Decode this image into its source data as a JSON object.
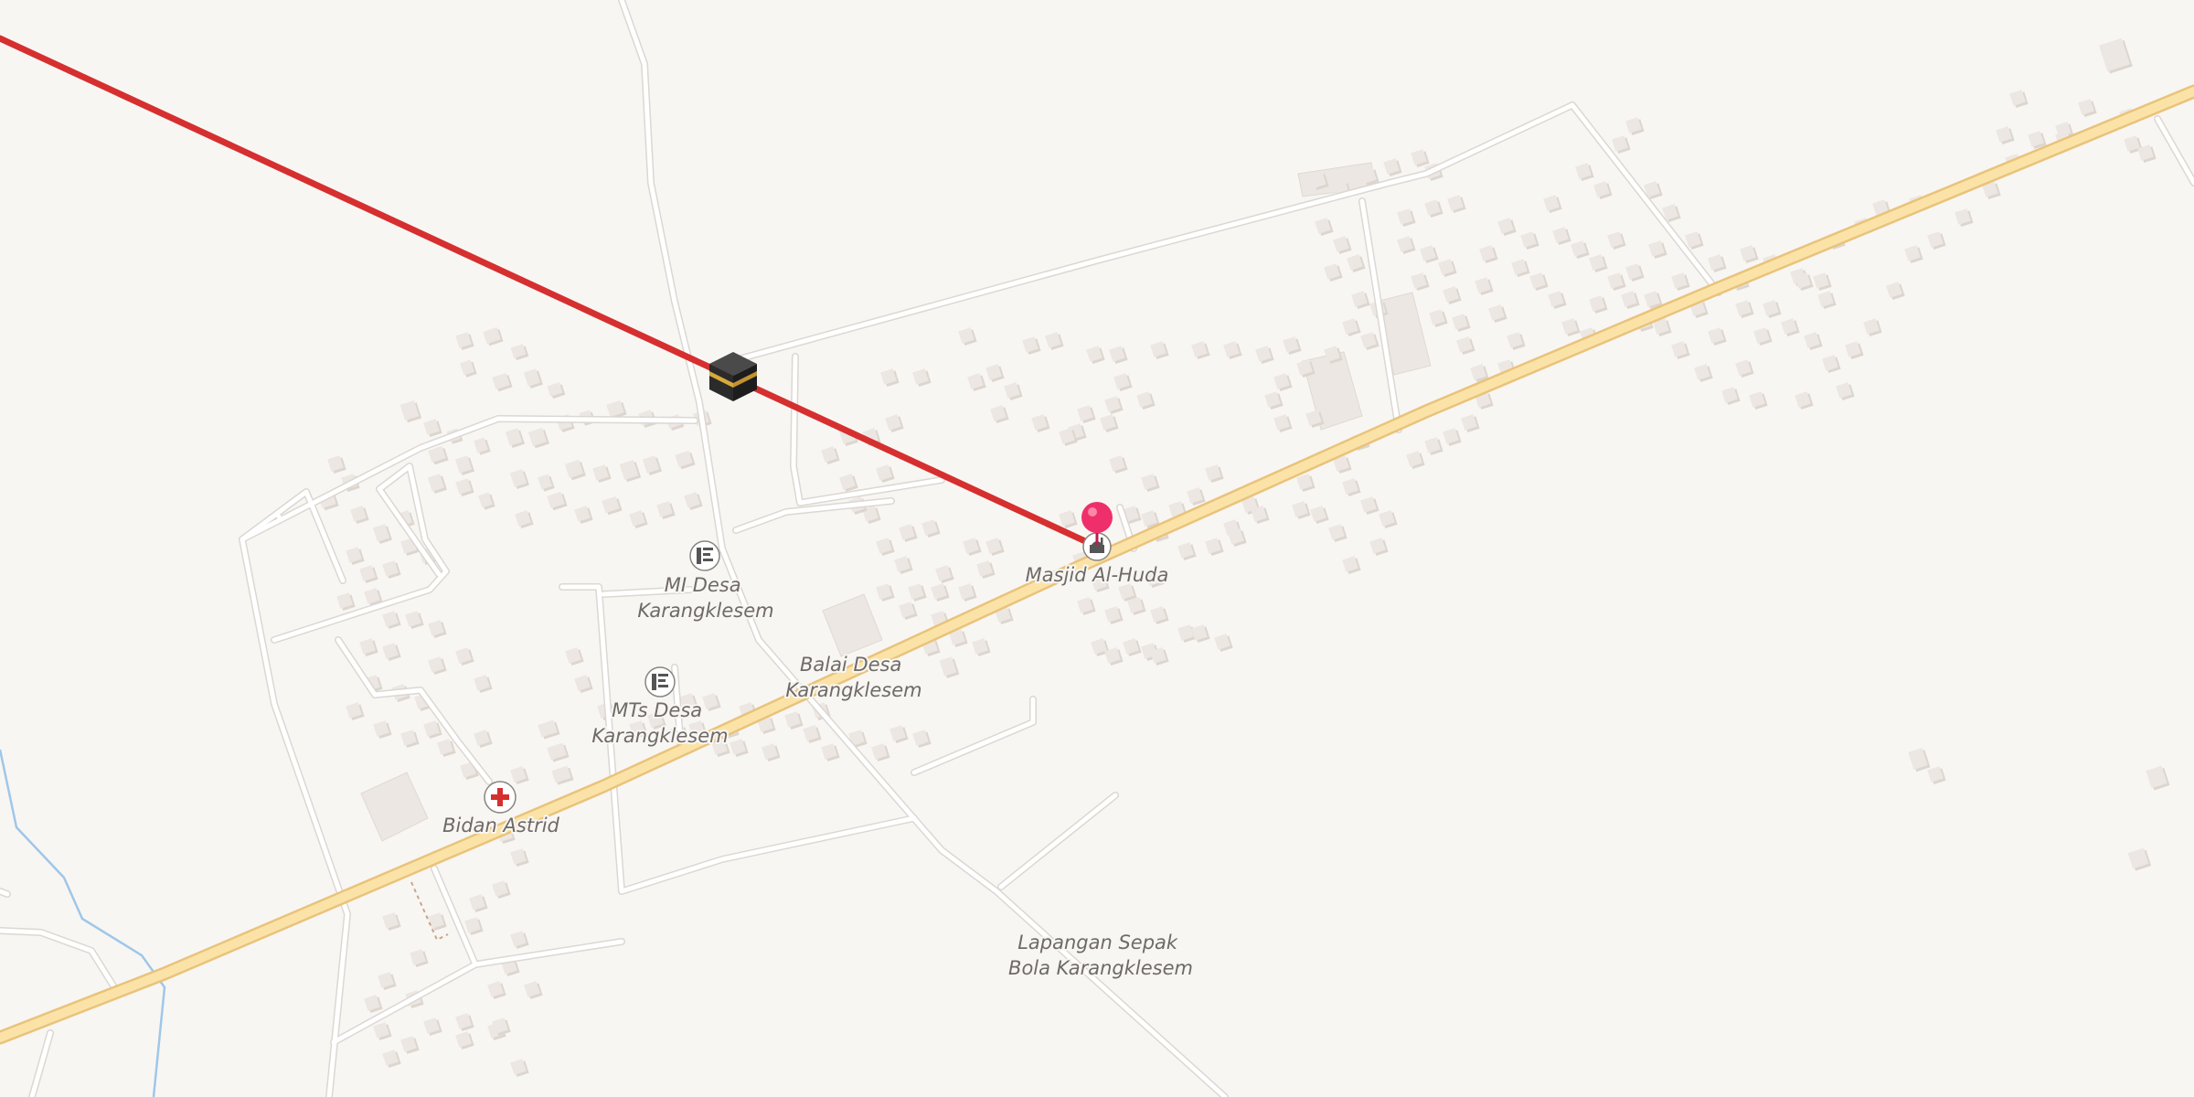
{
  "map": {
    "colors": {
      "background": "#f8f6f3",
      "road_minor": "#ffffff",
      "road_minor_casing": "#dcd7d2",
      "road_primary": "#fbe3a8",
      "road_primary_casing": "#e9c37b",
      "building": "#ece7e2",
      "building_shadow": "#ddd6cf",
      "water": "#9fc7e8",
      "qibla_line": "#d62f2f",
      "pin": "#ef2f6b"
    },
    "qibla": {
      "icon": "kaaba-icon",
      "line_color": "#d62f2f"
    },
    "location_pin": {
      "icon": "map-pin-icon",
      "color": "#ef2f6b"
    },
    "pois": [
      {
        "id": "masjid-al-huda",
        "icon": "mosque-icon",
        "lines": [
          "Masjid Al-Huda"
        ]
      },
      {
        "id": "mi-desa",
        "icon": "school-icon",
        "lines": [
          "MI Desa",
          "Karangklesem"
        ]
      },
      {
        "id": "mts-desa",
        "icon": "school-icon",
        "lines": [
          "MTs Desa",
          "Karangklesem"
        ]
      },
      {
        "id": "bidan-astrid",
        "icon": "medical-cross-icon",
        "lines": [
          "Bidan Astrid"
        ]
      },
      {
        "id": "balai-desa",
        "icon": "",
        "lines": [
          "Balai Desa",
          "Karangklesem"
        ]
      },
      {
        "id": "lapangan",
        "icon": "",
        "lines": [
          "Lapangan Sepak",
          "Bola Karangklesem"
        ]
      }
    ]
  }
}
